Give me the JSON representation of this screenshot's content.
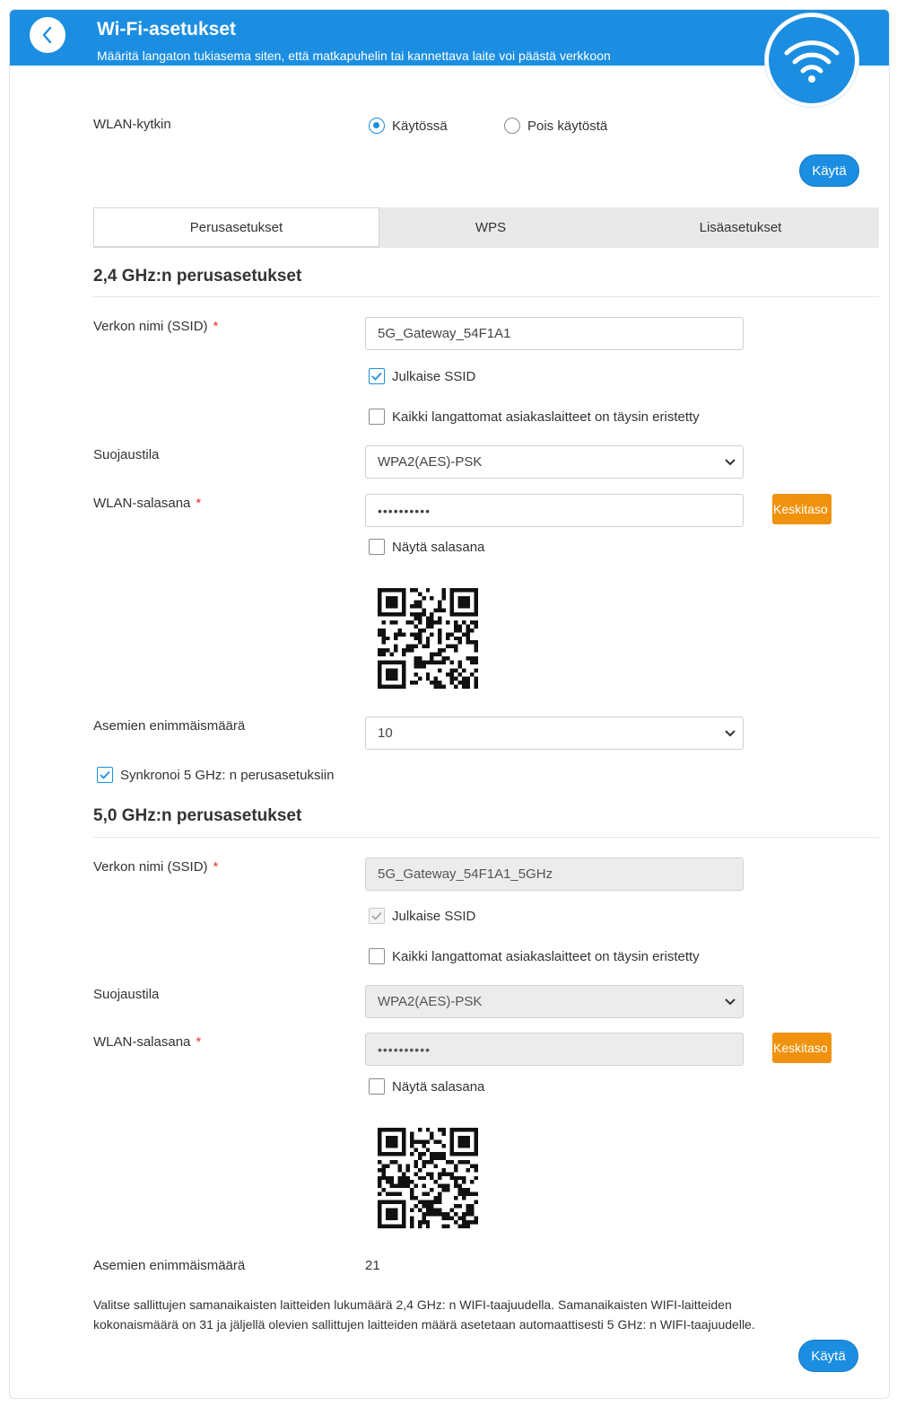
{
  "header": {
    "title": "Wi-Fi-asetukset",
    "subtitle": "Määritä langaton tukiasema siten, että matkapuhelin tai kannettava laite voi päästä verkkoon"
  },
  "wlan_switch": {
    "label": "WLAN-kytkin",
    "option_on": "Käytössä",
    "option_off": "Pois käytöstä",
    "selected": "Käytössä"
  },
  "apply_label": "Käytä",
  "tabs": [
    {
      "label": "Perusasetukset",
      "active": true
    },
    {
      "label": "WPS",
      "active": false
    },
    {
      "label": "Lisäasetukset",
      "active": false
    }
  ],
  "band24": {
    "title": "2,4 GHz:n perusasetukset",
    "ssid_label": "Verkon nimi (SSID)",
    "ssid_value": "5G_Gateway_54F1A1",
    "broadcast_label": "Julkaise SSID",
    "broadcast_checked": true,
    "isolation_label": "Kaikki langattomat asiakaslaitteet on täysin eristetty",
    "isolation_checked": false,
    "security_label": "Suojaustila",
    "security_value": "WPA2(AES)-PSK",
    "password_label": "WLAN-salasana",
    "password_value": "••••••••••",
    "strength_label": "Keskitaso",
    "show_password_label": "Näytä salasana",
    "show_password_checked": false,
    "max_stations_label": "Asemien enimmäismäärä",
    "max_stations_value": "10",
    "sync_label": "Synkronoi 5 GHz: n perusasetuksiin",
    "sync_checked": true
  },
  "band50": {
    "title": "5,0 GHz:n perusasetukset",
    "ssid_label": "Verkon nimi (SSID)",
    "ssid_value": "5G_Gateway_54F1A1_5GHz",
    "broadcast_label": "Julkaise SSID",
    "broadcast_checked": true,
    "isolation_label": "Kaikki langattomat asiakaslaitteet on täysin eristetty",
    "isolation_checked": false,
    "security_label": "Suojaustila",
    "security_value": "WPA2(AES)-PSK",
    "password_label": "WLAN-salasana",
    "password_value": "••••••••••",
    "strength_label": "Keskitaso",
    "show_password_label": "Näytä salasana",
    "show_password_checked": false,
    "max_stations_label": "Asemien enimmäismäärä",
    "max_stations_value": "21"
  },
  "note_line1": "Valitse sallittujen samanaikaisten laitteiden lukumäärä 2,4 GHz: n WIFI-taajuudella. Samanaikaisten WIFI-laitteiden",
  "note_line2": "kokonaismäärä on 31 ja jäljellä olevien sallittujen laitteiden määrä asetetaan automaattisesti 5 GHz: n WIFI-taajuudelle.",
  "colors": {
    "brand_blue": "#1b8ee2",
    "strength_orange": "#f0920d",
    "required_red": "#e5322d"
  },
  "icons": {
    "back": "chevron-left-icon",
    "wifi": "wifi-icon",
    "dropdown": "chevron-down-icon",
    "check": "check-icon"
  }
}
